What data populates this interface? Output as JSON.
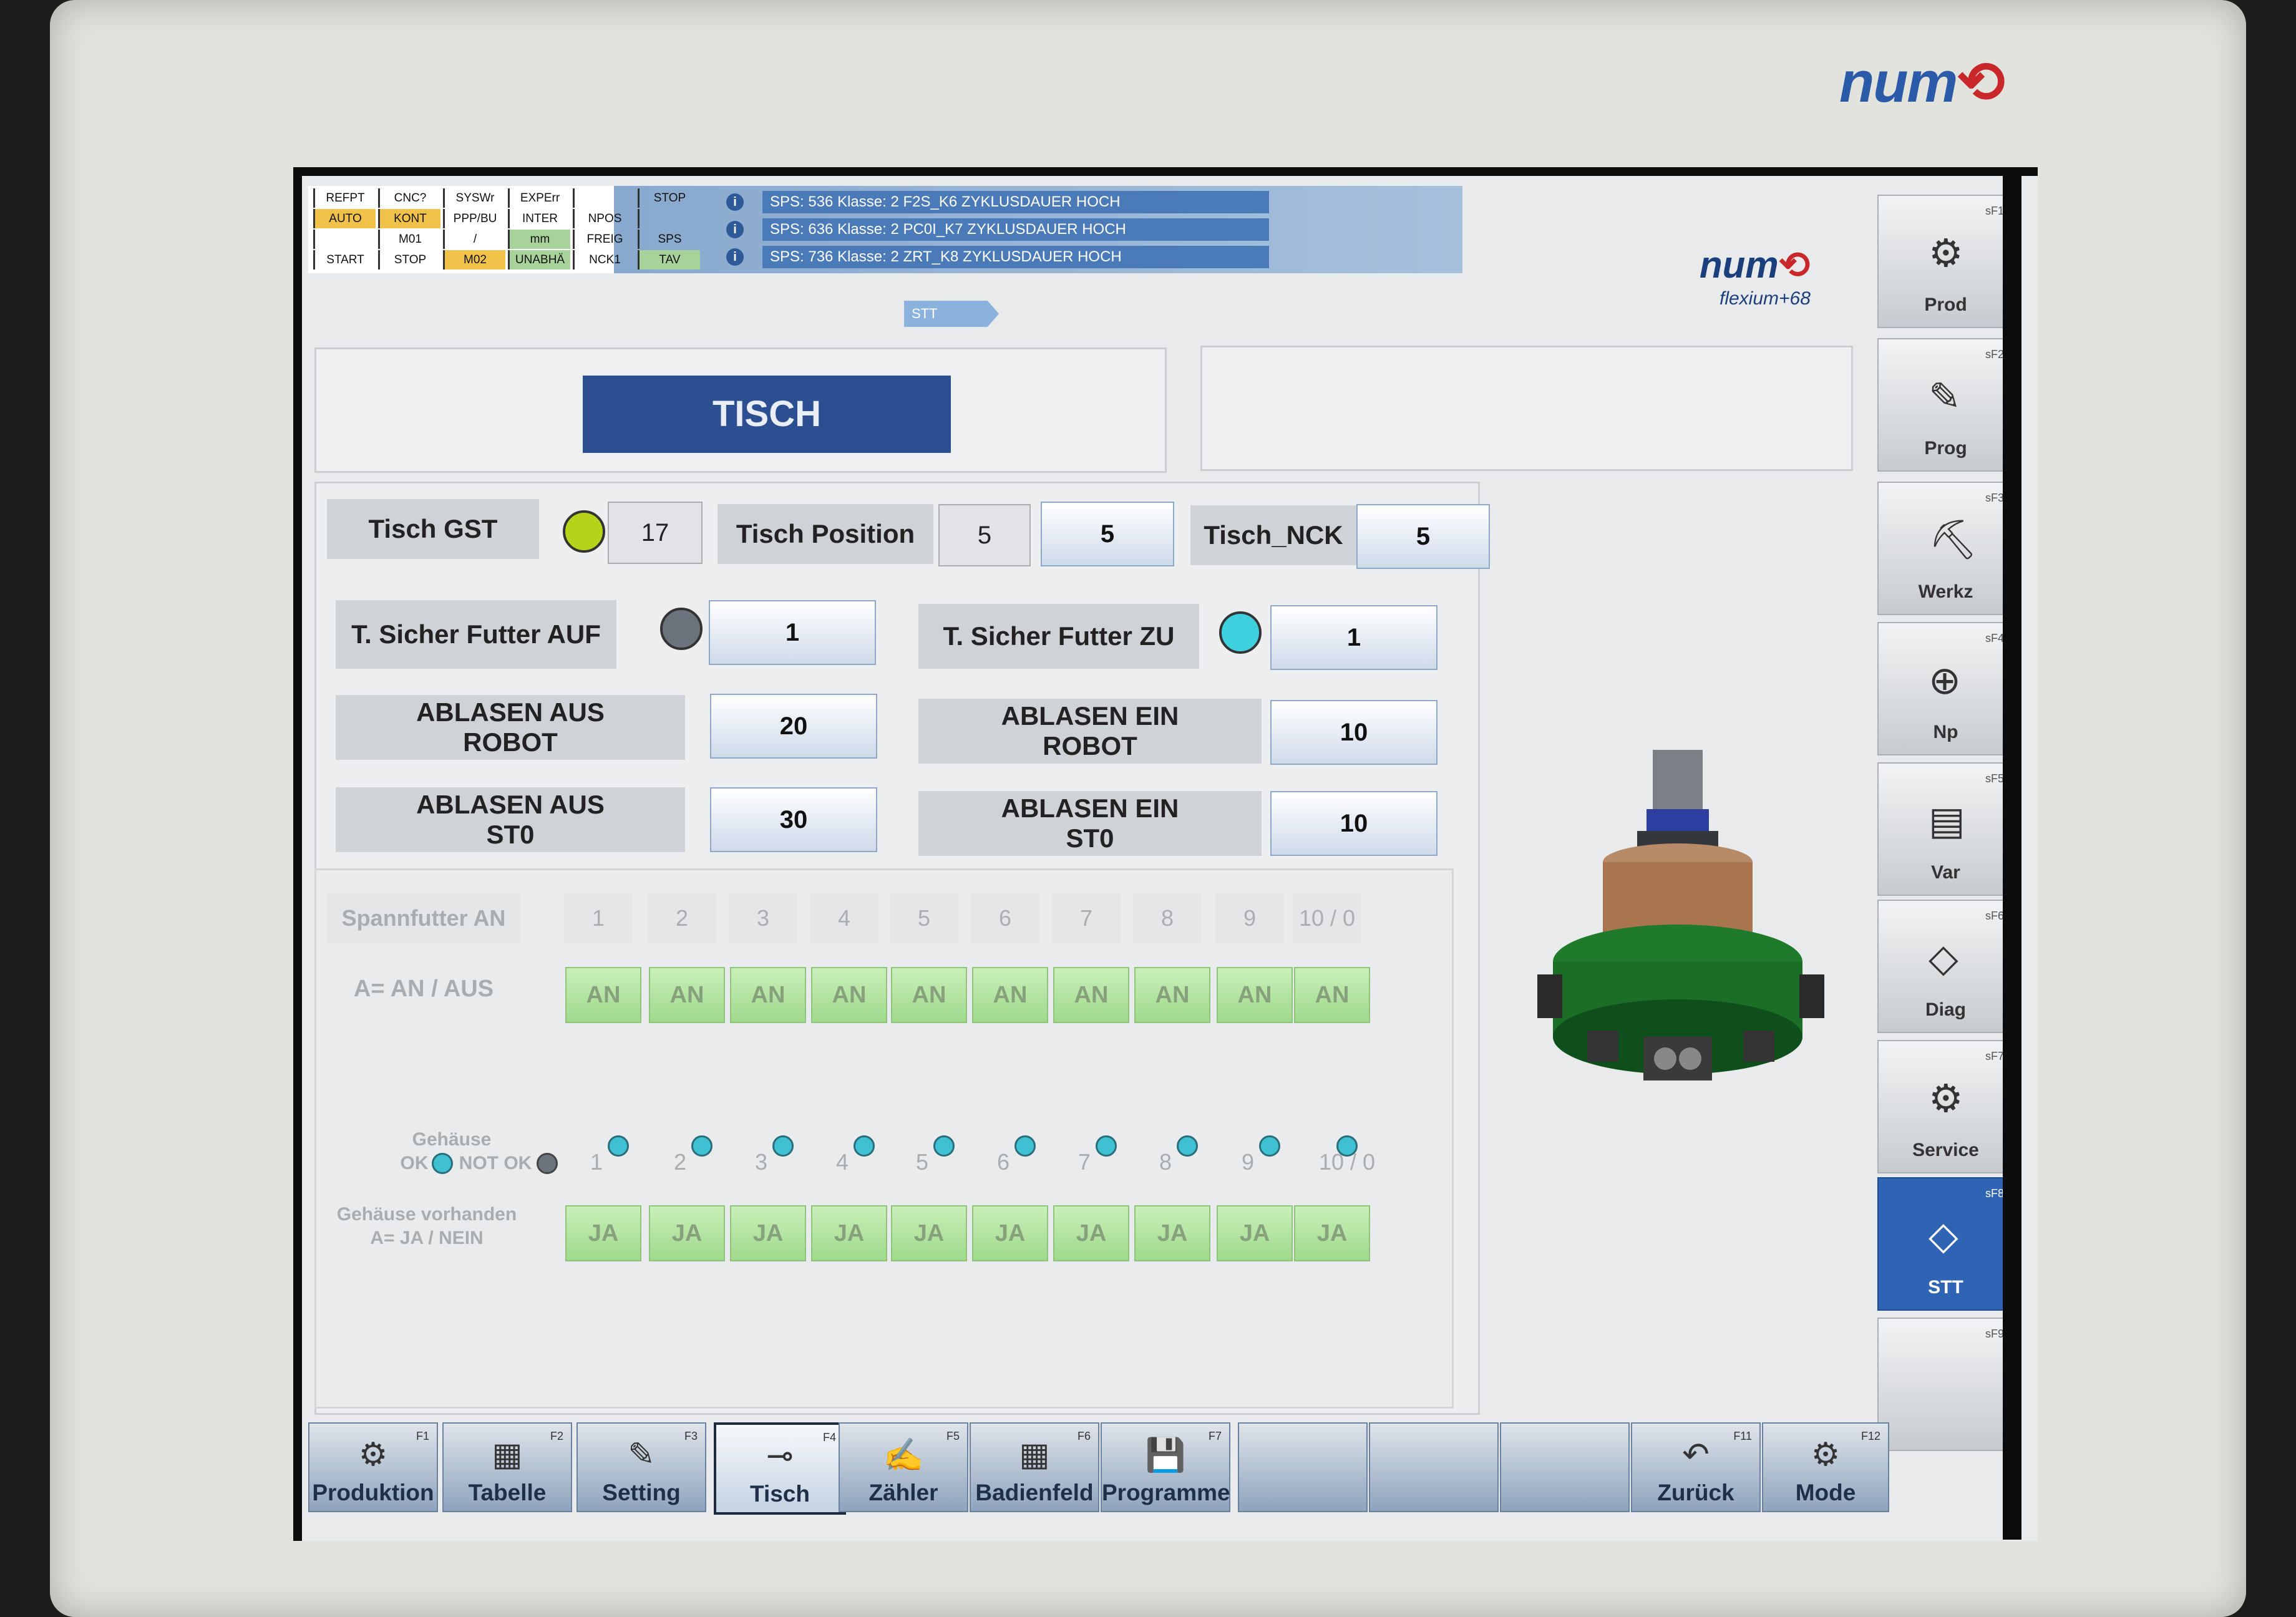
{
  "brand": "num",
  "status_grid": [
    [
      "REFPT",
      "CNC?",
      "SYSWr",
      "EXPErr",
      "",
      "STOP"
    ],
    [
      "AUTO",
      "KONT",
      "PPP/BU",
      "INTER",
      "NPOS",
      ""
    ],
    [
      "",
      "M01",
      "/",
      "mm",
      "FREIG",
      "SPS"
    ],
    [
      "START",
      "STOP",
      "M02",
      "UNABHÄ",
      "NCK1",
      "TAV"
    ]
  ],
  "messages": [
    "SPS: 536 Klasse: 2 F2S_K6 ZYKLUSDAUER HOCH",
    "SPS: 636 Klasse: 2 PC0I_K7 ZYKLUSDAUER HOCH",
    "SPS: 736 Klasse: 2 ZRT_K8 ZYKLUSDAUER HOCH"
  ],
  "info_icon": "i",
  "breadcrumb": "STT",
  "logo": {
    "name": "num",
    "sub": "flexium+68"
  },
  "page_title": "TISCH",
  "table_row": {
    "gst_label": "Tisch GST",
    "gst_value": "17",
    "pos_label": "Tisch Position",
    "pos_value1": "5",
    "pos_value2": "5",
    "nck_label": "Tisch_NCK",
    "nck_value": "5"
  },
  "futter": {
    "auf_label": "T. Sicher Futter AUF",
    "auf_value": "1",
    "zu_label": "T. Sicher Futter ZU",
    "zu_value": "1"
  },
  "ablasen": {
    "aus_robot_label": "ABLASEN AUS ROBOT",
    "aus_robot_value": "20",
    "ein_robot_label": "ABLASEN EIN ROBOT",
    "ein_robot_value": "10",
    "aus_st0_label": "ABLASEN AUS ST0",
    "aus_st0_value": "30",
    "ein_st0_label": "ABLASEN EIN ST0",
    "ein_st0_value": "10"
  },
  "spannfutter": {
    "label": "Spannfutter AN",
    "mode_label": "A= AN / AUS",
    "columns": [
      "1",
      "2",
      "3",
      "4",
      "5",
      "6",
      "7",
      "8",
      "9",
      "10 / 0"
    ],
    "an_buttons": [
      "AN",
      "AN",
      "AN",
      "AN",
      "AN",
      "AN",
      "AN",
      "AN",
      "AN",
      "AN"
    ]
  },
  "gehaeuse": {
    "title": "Gehäuse",
    "ok_label": "OK",
    "not_ok_label": "NOT OK",
    "columns": [
      "1",
      "2",
      "3",
      "4",
      "5",
      "6",
      "7",
      "8",
      "9",
      "10 / 0"
    ],
    "vorhanden_label": "Gehäuse vorhanden",
    "vorhanden_sub": "A= JA / NEIN",
    "ja_buttons": [
      "JA",
      "JA",
      "JA",
      "JA",
      "JA",
      "JA",
      "JA",
      "JA",
      "JA",
      "JA"
    ]
  },
  "side_keys": [
    {
      "label": "Prod",
      "fkey": "sF1",
      "icon": "⚙"
    },
    {
      "label": "Prog",
      "fkey": "sF2",
      "icon": "✎"
    },
    {
      "label": "Werkz",
      "fkey": "sF3",
      "icon": "⛏"
    },
    {
      "label": "Np",
      "fkey": "sF4",
      "icon": "⊕"
    },
    {
      "label": "Var",
      "fkey": "sF5",
      "icon": "▤"
    },
    {
      "label": "Diag",
      "fkey": "sF6",
      "icon": "◇"
    },
    {
      "label": "Service",
      "fkey": "sF7",
      "icon": "⚙"
    },
    {
      "label": "STT",
      "fkey": "sF8",
      "icon": "◇"
    },
    {
      "label": "",
      "fkey": "sF9",
      "icon": ""
    }
  ],
  "bottom_keys": [
    {
      "label": "Produktion",
      "fkey": "F1",
      "icon": "⚙"
    },
    {
      "label": "Tabelle",
      "fkey": "F2",
      "icon": "▦"
    },
    {
      "label": "Setting",
      "fkey": "F3",
      "icon": "✎"
    },
    {
      "label": "Tisch",
      "fkey": "F4",
      "icon": "⊸"
    },
    {
      "label": "Zähler",
      "fkey": "F5",
      "icon": "✍"
    },
    {
      "label": "Badienfeld",
      "fkey": "F6",
      "icon": "▦"
    },
    {
      "label": "Programme",
      "fkey": "F7",
      "icon": "💾"
    },
    {
      "label": "",
      "fkey": "",
      "icon": ""
    },
    {
      "label": "",
      "fkey": "",
      "icon": ""
    },
    {
      "label": "",
      "fkey": "",
      "icon": ""
    },
    {
      "label": "Zurück",
      "fkey": "F11",
      "icon": "↶"
    },
    {
      "label": "Mode",
      "fkey": "F12",
      "icon": "⚙"
    }
  ],
  "colors": {
    "title_bar": "#2c4f91",
    "active_key": "#2e64b3",
    "led_yellow": "#b6d21a",
    "led_grey": "#6b747c",
    "led_cyan": "#3fd0e0"
  }
}
